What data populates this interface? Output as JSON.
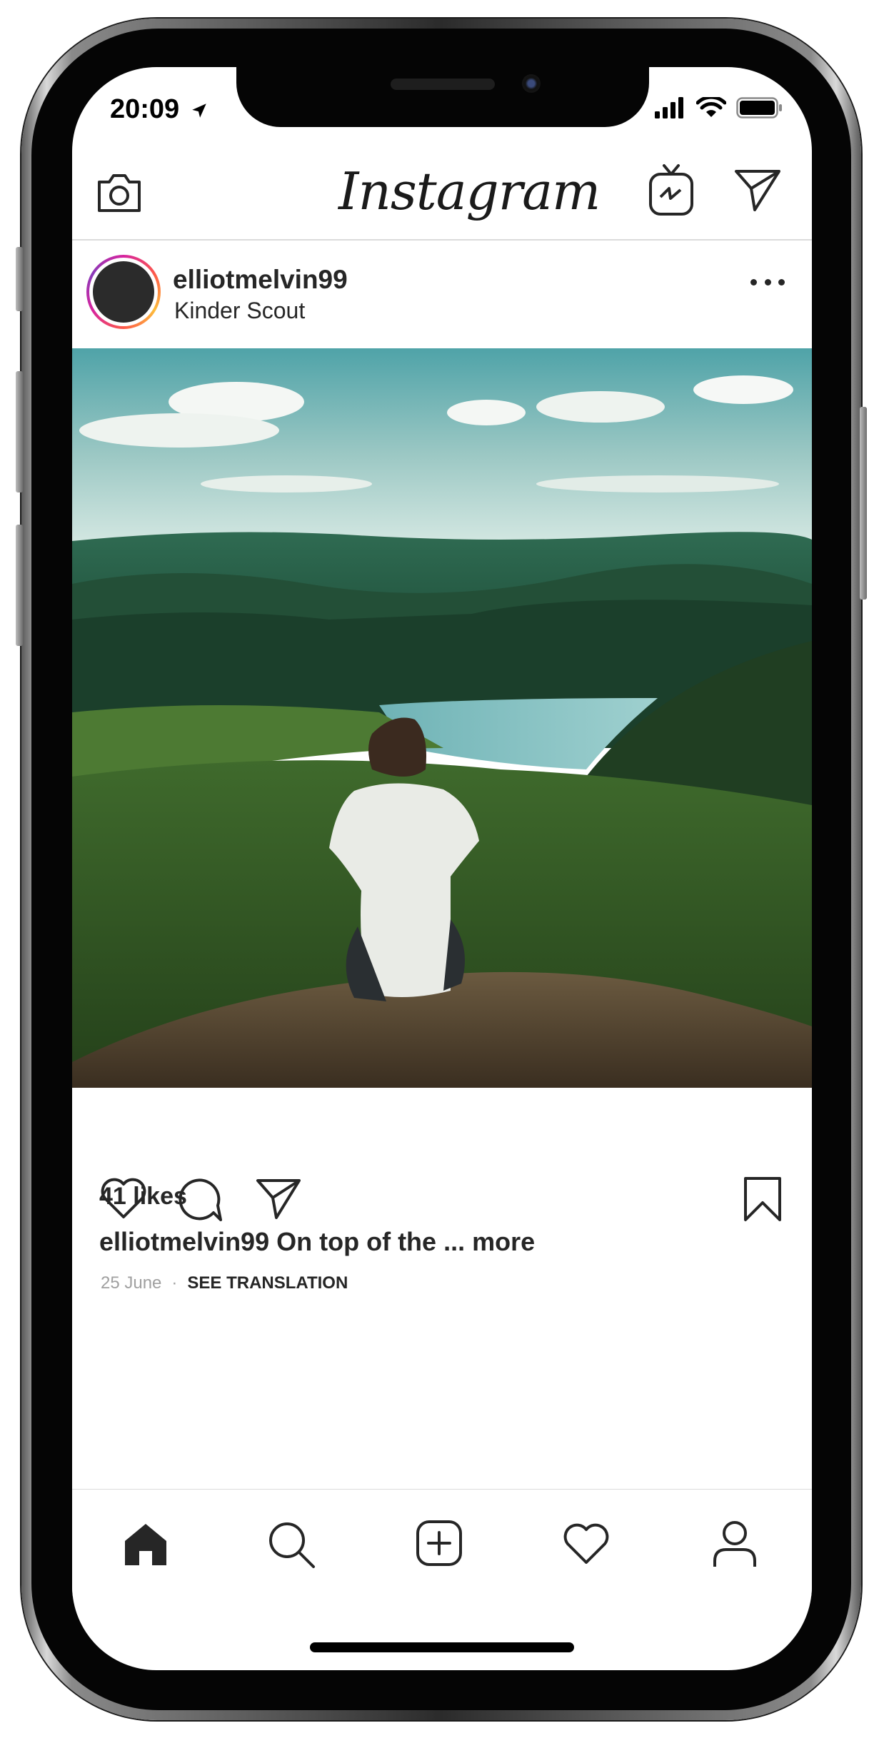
{
  "status_bar": {
    "time": "20:09",
    "icons": [
      "location-arrow-icon",
      "signal-icon",
      "wifi-icon",
      "battery-icon"
    ]
  },
  "header": {
    "app_name": "Instagram",
    "left_icon": "camera-icon",
    "right_icons": [
      "igtv-icon",
      "direct-message-icon"
    ]
  },
  "post": {
    "username": "elliotmelvin99",
    "location": "Kinder Scout",
    "likes": "41 likes",
    "caption_user": "elliotmelvin99",
    "caption_text": "On top of the ...",
    "caption_more": "more",
    "date": "25 June",
    "separator": "·",
    "translate_label": "SEE TRANSLATION",
    "actions": [
      "heart-icon",
      "comment-icon",
      "share-icon",
      "bookmark-icon"
    ]
  },
  "tab_bar": {
    "items": [
      "home-icon",
      "search-icon",
      "add-post-icon",
      "activity-heart-icon",
      "profile-icon"
    ]
  },
  "colors": {
    "ring_gradient": [
      "#d6249f",
      "#fd5949",
      "#fdbd3b",
      "#8a3ab9"
    ],
    "text": "#262626",
    "meta": "#a0a0a0",
    "divider": "#dbdbdb"
  }
}
